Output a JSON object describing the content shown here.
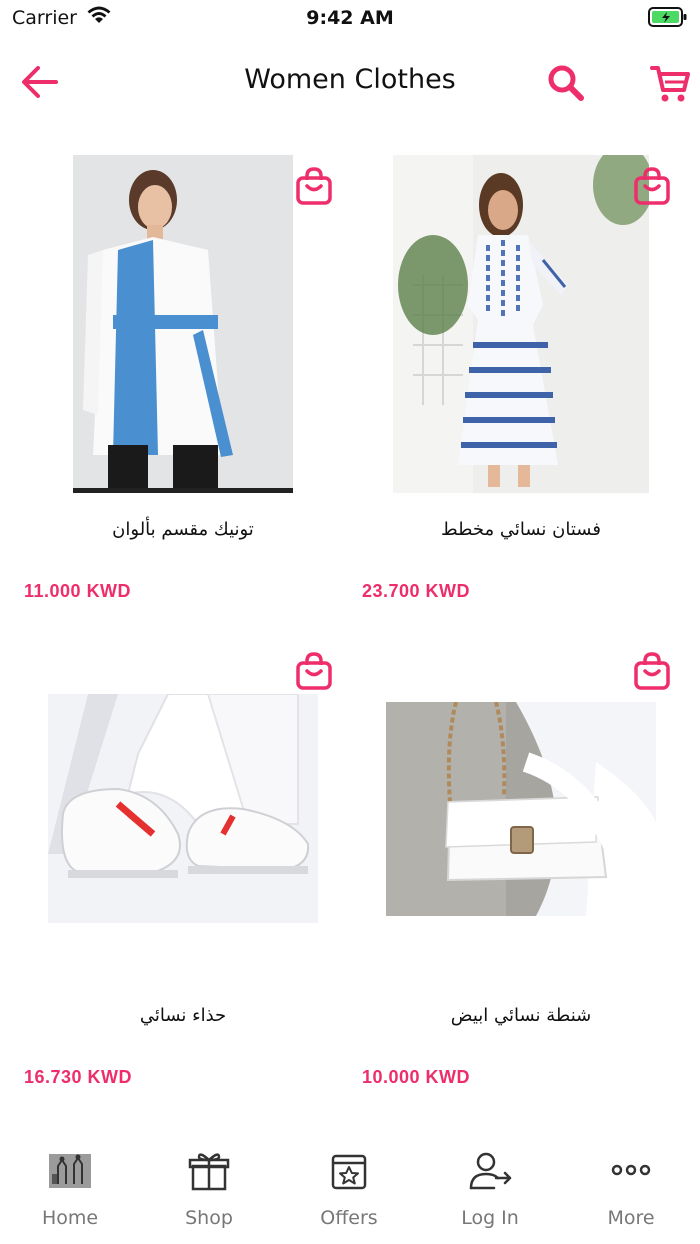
{
  "status_bar": {
    "carrier": "Carrier",
    "time": "9:42 AM"
  },
  "header": {
    "title": "Women Clothes"
  },
  "colors": {
    "accent": "#ee2d6b",
    "tab_label": "#777777"
  },
  "icons": {
    "back": "arrow-left-icon",
    "search": "search-icon",
    "cart": "cart-icon",
    "add_to_bag": "shopping-bag-icon"
  },
  "products": [
    {
      "name": "تونيك مقسم بألوان",
      "price": "11.000 KWD"
    },
    {
      "name": "فستان نسائي مخطط",
      "price": "23.700 KWD"
    },
    {
      "name": "حذاء نسائي",
      "price": "16.730 KWD"
    },
    {
      "name": "شنطة نسائي ابيض",
      "price": "10.000 KWD"
    }
  ],
  "tabbar": {
    "items": [
      {
        "label": "Home",
        "icon": "store-logo-icon"
      },
      {
        "label": "Shop",
        "icon": "gift-icon"
      },
      {
        "label": "Offers",
        "icon": "star-calendar-icon"
      },
      {
        "label": "Log In",
        "icon": "user-login-icon"
      },
      {
        "label": "More",
        "icon": "more-dots-icon"
      }
    ]
  }
}
